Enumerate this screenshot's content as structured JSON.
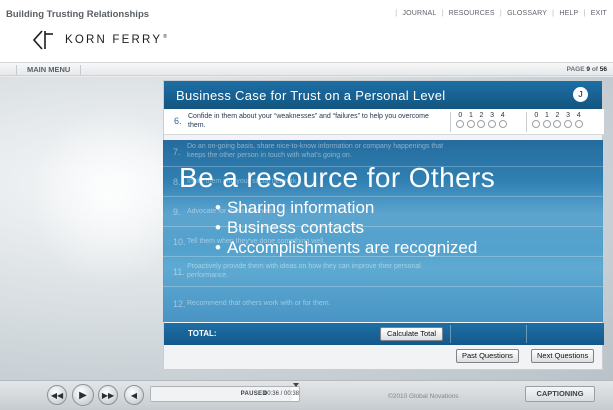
{
  "header": {
    "course_title": "Building Trusting Relationships",
    "links": [
      "JOURNAL",
      "RESOURCES",
      "GLOSSARY",
      "HELP",
      "EXIT"
    ],
    "logo_text": "KORN FERRY",
    "logo_tm": "®"
  },
  "menubar": {
    "main_menu_label": "MAIN MENU",
    "page_label": "PAGE",
    "page_current": "9",
    "page_of": "of",
    "page_total": "56"
  },
  "panel": {
    "title": "Business Case for Trust on a Personal Level",
    "avatar_letter": "J",
    "rating_scale": [
      "0",
      "1",
      "2",
      "3",
      "4"
    ],
    "question_6": {
      "number": "6.",
      "text": "Confide in them about your “weaknesses” and “failures” to help you overcome them."
    },
    "faded_questions": [
      {
        "number": "7.",
        "text": "Do an on-going basis, share nice-to-know information or company happenings that keeps the other person in touch with what's going on."
      },
      {
        "number": "8.",
        "text": "Invite them into your social network."
      },
      {
        "number": "9.",
        "text": "Advocate for them to others."
      },
      {
        "number": "10.",
        "text": "Tell them when they've done something well."
      },
      {
        "number": "11.",
        "text": "Proactively provide them with ideas on how they can improve their personal performance."
      },
      {
        "number": "12.",
        "text": "Recommend that others work with or for them."
      }
    ],
    "total_label": "TOTAL:",
    "calculate_label": "Calculate Total",
    "past_label": "Past Questions",
    "next_label": "Next Questions"
  },
  "overlay": {
    "headline": "Be a resource for Others",
    "bullets": [
      "Sharing information",
      "Business contacts",
      "Accomplishments are recognized"
    ]
  },
  "player": {
    "status": "PAUSED",
    "timecode": "00:36 / 00:38",
    "progress_fraction": 0.95,
    "copyright": "©2010 Global Novations",
    "captioning_label": "CAPTIONING"
  }
}
